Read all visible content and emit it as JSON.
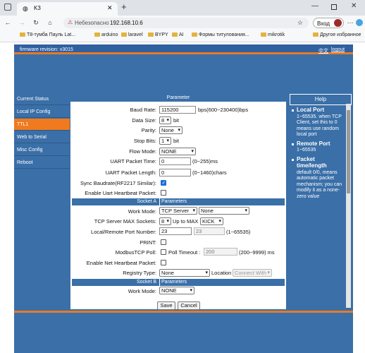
{
  "browser": {
    "tab_title": "K3",
    "url": "192.168.10.6",
    "insecure_label": "Небезопасно",
    "login_label": "Вход",
    "bookmarks": [
      "Т8-тумба Пауль Lat...",
      "arduino",
      "laravel",
      "BYPY",
      "AI",
      "Формы титулования...",
      "mikrotik"
    ],
    "other_bookmarks": "Другое избранное"
  },
  "page": {
    "firmware": "firmware revision:  v3015",
    "lang_link": "中文",
    "logout": "logout"
  },
  "menu": [
    "Current Status",
    "Local IP Config",
    "TTL1",
    "Web to Serial",
    "Misc Config",
    "Reboot"
  ],
  "panel": {
    "title": "Parameter",
    "baud_label": "Baud Rate:",
    "baud_value": "115200",
    "baud_hint": "bps(600~230400)bps",
    "datasize_label": "Data Size:",
    "datasize_value": "8",
    "datasize_unit": "bit",
    "parity_label": "Parity:",
    "parity_value": "None",
    "stopbits_label": "Stop Bits:",
    "stopbits_value": "1",
    "stopbits_unit": "bit",
    "flow_label": "Flow Mode:",
    "flow_value": "NONE",
    "uart_time_label": "UART Packet Time:",
    "uart_time_value": "0",
    "uart_time_hint": "(0~255)ms",
    "uart_len_label": "UART Packet Length:",
    "uart_len_value": "0",
    "uart_len_hint": "(0~1460)chars",
    "sync_label": "Sync Baudrate(RF2217 Similar):",
    "heartbeat_label": "Enable Uart Heartbeat Packet:",
    "socketA_left": "Socket A",
    "socketA_right": "Parameters",
    "workmode_label": "Work Mode:",
    "workmode_value": "TCP Server",
    "workmode_value2": "None",
    "maxsock_label": "TCP Server MAX Sockets:",
    "maxsock_value": "8",
    "maxsock_mid": "Up to MAX",
    "maxsock_action": "KICK",
    "port_label": "Local/Remote Port Number:",
    "port_local": "23",
    "port_remote": "23",
    "port_hint": "(1~65535)",
    "print_label": "PRINT:",
    "modbus_label": "ModbusTCP Poll:",
    "poll_timeout_label": "Poll Timeout :",
    "poll_timeout_value": "200",
    "poll_timeout_hint": "(200~9999) ms",
    "net_heartbeat_label": "Enable Net Heartbeat Packet:",
    "registry_label": "Registry Type:",
    "registry_value": "None",
    "location_label": "Location",
    "location_value": "Connect With",
    "socketB_left": "Socket B",
    "socketB_right": "Parameters",
    "workmodeB_label": "Work Mode:",
    "workmodeB_value": "NONE",
    "save": "Save",
    "cancel": "Cancel"
  },
  "help": {
    "title": "Help",
    "items": [
      {
        "title": "Local Port",
        "text": "1~65535. when TCP Client, set this to 0 means use random local port"
      },
      {
        "title": "Remote Port",
        "text": "1~65535"
      },
      {
        "title": "Packet time/length",
        "text": "default 0/0, means automatic packet mechanism; you can modify it as a none-zero value"
      }
    ]
  },
  "colors": {
    "frame": "#3a6fa8",
    "accent": "#f07a1d",
    "checkbox_on": "#1a6fd6"
  }
}
